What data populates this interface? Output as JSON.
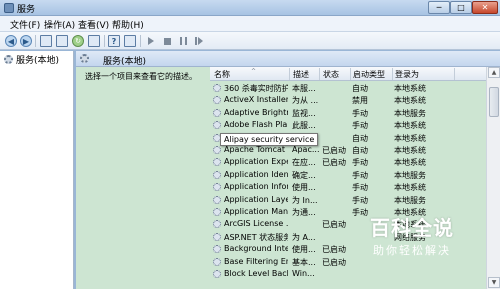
{
  "window": {
    "title": "服务",
    "minimize": "─",
    "maximize": "□",
    "close": "✕"
  },
  "menu": [
    "文件(F)",
    "操作(A)",
    "查看(V)",
    "帮助(H)"
  ],
  "nav": {
    "root": "服务(本地)"
  },
  "content": {
    "header": "服务(本地)",
    "description_prompt": "选择一个项目来查看它的描述。"
  },
  "columns": {
    "name": "名称",
    "sort": "^",
    "desc": "描述",
    "status": "状态",
    "startup": "启动类型",
    "logon": "登录为"
  },
  "services": [
    {
      "name": "360 杀毒实时防护...",
      "desc": "本服...",
      "status": "",
      "startup": "自动",
      "logon": "本地系统"
    },
    {
      "name": "ActiveX Installer ...",
      "desc": "为从 ...",
      "status": "",
      "startup": "禁用",
      "logon": "本地系统"
    },
    {
      "name": "Adaptive Brightn...",
      "desc": "监视...",
      "status": "",
      "startup": "手动",
      "logon": "本地服务"
    },
    {
      "name": "Adobe Flash Pla...",
      "desc": "此服...",
      "status": "",
      "startup": "手动",
      "logon": "本地系统"
    },
    {
      "name": "Alipay security service",
      "desc": "",
      "status": "",
      "startup": "自动",
      "logon": "本地系统"
    },
    {
      "name": "Apache Tomcat ...",
      "desc": "Apac...",
      "status": "已启动",
      "startup": "自动",
      "logon": "本地系统"
    },
    {
      "name": "Application Expe...",
      "desc": "在应...",
      "status": "已启动",
      "startup": "手动",
      "logon": "本地系统"
    },
    {
      "name": "Application Iden...",
      "desc": "确定...",
      "status": "",
      "startup": "手动",
      "logon": "本地服务"
    },
    {
      "name": "Application Infor...",
      "desc": "使用...",
      "status": "",
      "startup": "手动",
      "logon": "本地系统"
    },
    {
      "name": "Application Laye...",
      "desc": "为 In...",
      "status": "",
      "startup": "手动",
      "logon": "本地服务"
    },
    {
      "name": "Application Man...",
      "desc": "为通...",
      "status": "",
      "startup": "手动",
      "logon": "本地系统"
    },
    {
      "name": "ArcGIS License ...",
      "desc": "",
      "status": "已启动",
      "startup": "",
      "logon": "本地系统"
    },
    {
      "name": "ASP.NET 状态服务",
      "desc": "为 A...",
      "status": "",
      "startup": "",
      "logon": "网络服务"
    },
    {
      "name": "Background Inte...",
      "desc": "使用...",
      "status": "已启动",
      "startup": "",
      "logon": ""
    },
    {
      "name": "Base Filtering En...",
      "desc": "基本...",
      "status": "已启动",
      "startup": "",
      "logon": ""
    },
    {
      "name": "Block Level Back...",
      "desc": "Win...",
      "status": "",
      "startup": "",
      "logon": ""
    }
  ],
  "tooltip": "Alipay security service",
  "watermark": {
    "title": "百科全说",
    "subtitle": "助你轻松解决"
  },
  "colors": {
    "list_bg": "#cde5d2",
    "titlebar": "#b8d0ec",
    "close": "#c6472c"
  }
}
